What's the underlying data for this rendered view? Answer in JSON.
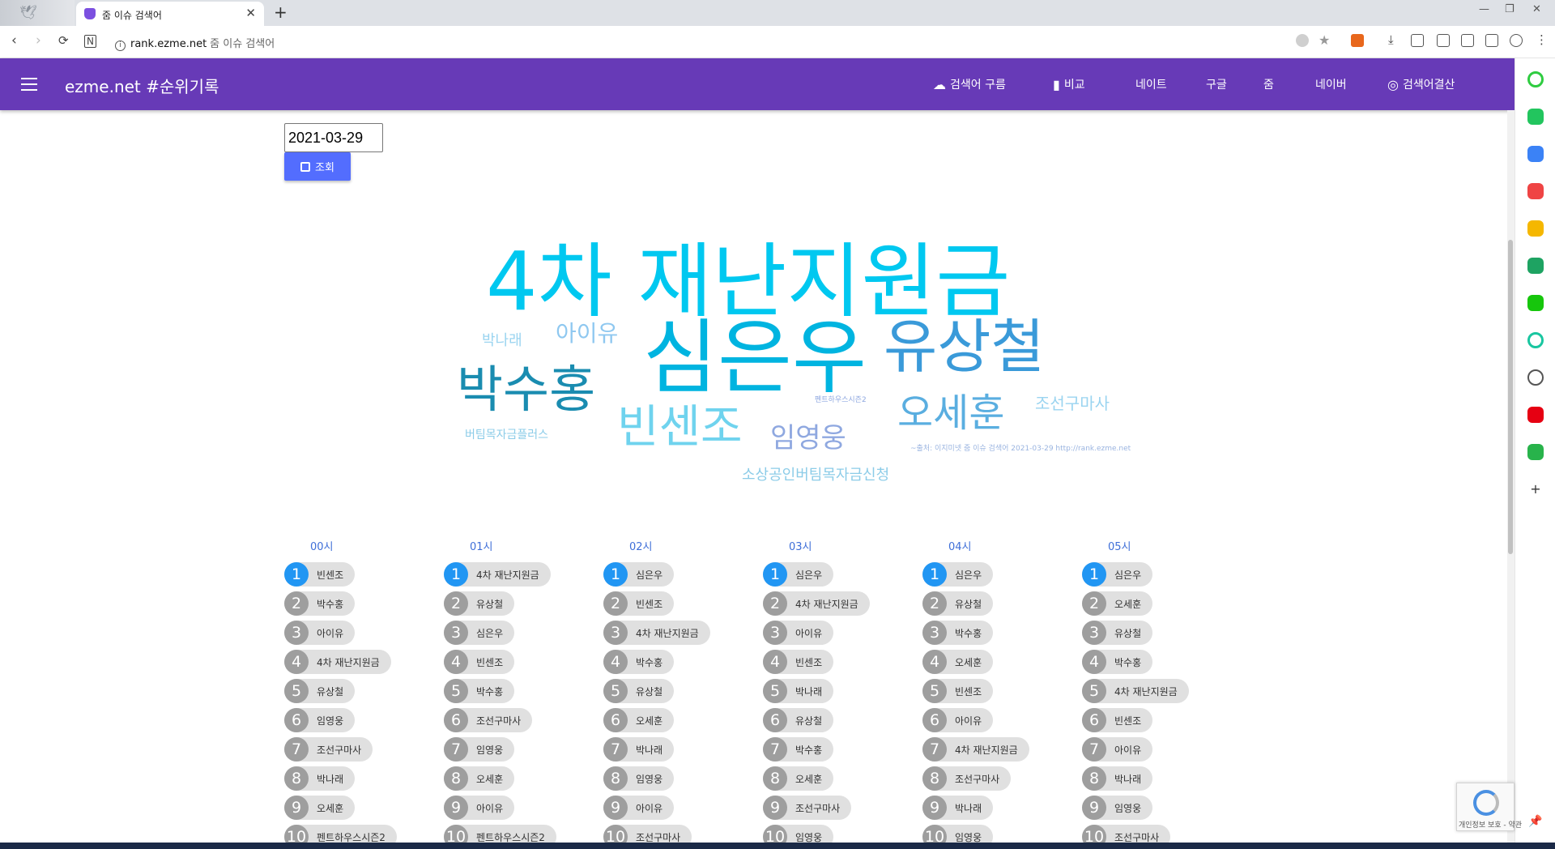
{
  "browser": {
    "tab_title": "줌 이슈 검색어",
    "url_domain": "rank.ezme.net",
    "url_page_title": "줌 이슈 검색어"
  },
  "site": {
    "title": "ezme.net #순위기록",
    "nav": [
      {
        "label": "검색어 구름",
        "icon": "cloud-icon"
      },
      {
        "label": "비교",
        "icon": "bar-chart-icon"
      },
      {
        "label": "네이트"
      },
      {
        "label": "구글"
      },
      {
        "label": "줌"
      },
      {
        "label": "네이버"
      },
      {
        "label": "검색어결산",
        "icon": "data-usage-icon"
      }
    ],
    "accent_color": "#673ab7"
  },
  "search": {
    "date_value": "2021-03-29",
    "button_label": "조회"
  },
  "word_cloud": {
    "words": [
      {
        "text": "4차 재난지원금",
        "color": "#00c8f0"
      },
      {
        "text": "심은우",
        "color": "#00b4e0"
      },
      {
        "text": "유상철",
        "color": "#3a9ad9"
      },
      {
        "text": "박수홍",
        "color": "#1a8cb0"
      },
      {
        "text": "빈센조",
        "color": "#6fd3ee"
      },
      {
        "text": "오세훈",
        "color": "#5aaee0"
      },
      {
        "text": "임영웅",
        "color": "#8fa8e0"
      },
      {
        "text": "아이유",
        "color": "#8fc8f0"
      },
      {
        "text": "박나래",
        "color": "#9ad4f0"
      },
      {
        "text": "조선구마사",
        "color": "#9ad4f0"
      },
      {
        "text": "버팀목자금플러스",
        "color": "#8ccce8"
      },
      {
        "text": "소상공인버팀목자금신청",
        "color": "#8ccce8"
      },
      {
        "text": "펜트하우스시즌2",
        "color": "#8fa8e0"
      }
    ],
    "credit": "~출처: 이지미넷 줌 이슈 검색어 2021-03-29 http://rank.ezme.net"
  },
  "hourly_rankings": [
    {
      "hour": "00시",
      "items": [
        "빈센조",
        "박수홍",
        "아이유",
        "4차 재난지원금",
        "유상철",
        "임영웅",
        "조선구마사",
        "박나래",
        "오세훈",
        "펜트하우스시즌2"
      ]
    },
    {
      "hour": "01시",
      "items": [
        "4차 재난지원금",
        "유상철",
        "심은우",
        "빈센조",
        "박수홍",
        "조선구마사",
        "임영웅",
        "오세훈",
        "아이유",
        "펜트하우스시즌2"
      ]
    },
    {
      "hour": "02시",
      "items": [
        "심은우",
        "빈센조",
        "4차 재난지원금",
        "박수홍",
        "유상철",
        "오세훈",
        "박나래",
        "임영웅",
        "아이유",
        "조선구마사"
      ]
    },
    {
      "hour": "03시",
      "items": [
        "심은우",
        "4차 재난지원금",
        "아이유",
        "빈센조",
        "박나래",
        "유상철",
        "박수홍",
        "오세훈",
        "조선구마사",
        "임영웅"
      ]
    },
    {
      "hour": "04시",
      "items": [
        "심은우",
        "유상철",
        "박수홍",
        "오세훈",
        "빈센조",
        "아이유",
        "4차 재난지원금",
        "조선구마사",
        "박나래",
        "임영웅"
      ]
    },
    {
      "hour": "05시",
      "items": [
        "심은우",
        "오세훈",
        "유상철",
        "박수홍",
        "4차 재난지원금",
        "빈센조",
        "아이유",
        "박나래",
        "임영웅",
        "조선구마사"
      ]
    }
  ],
  "rank_numbers": [
    "1",
    "2",
    "3",
    "4",
    "5",
    "6",
    "7",
    "8",
    "9",
    "10"
  ],
  "recaptcha": {
    "text": "개인정보 보호 - 약관"
  }
}
